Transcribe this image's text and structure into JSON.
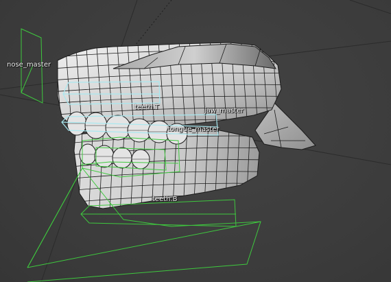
{
  "viewport": {
    "background": "#3d3d3d",
    "mesh_color": "#d9d9d9",
    "wire_color": "#1a1a1a",
    "bone_color": "#3ec93e",
    "selected_bone_color": "#a8e8f0",
    "grid_line_color": "#2a2a2a"
  },
  "bones": {
    "nose_master": "nose_master",
    "teeth_t": "teeth.T",
    "jaw_master": "jaw_master",
    "tongue_master": "tongue_master",
    "teeth_b": "teeth.B"
  }
}
